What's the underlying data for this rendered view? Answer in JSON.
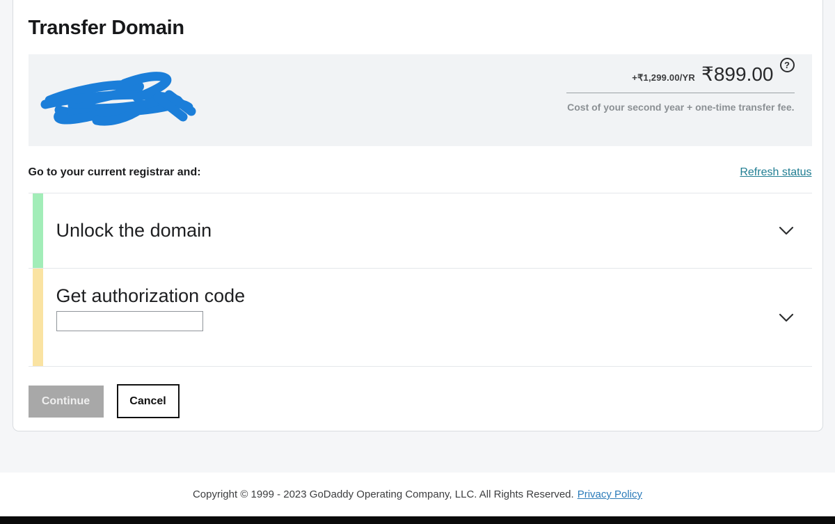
{
  "page": {
    "title": "Transfer Domain"
  },
  "pricing": {
    "renewal_price_per_year": "+₹1,299.00/YR",
    "transfer_price": "₹899.00",
    "help_glyph": "?",
    "note": "Cost of your second year + one-time transfer fee."
  },
  "instructions": {
    "label": "Go to your current registrar and:",
    "refresh_link": "Refresh status"
  },
  "steps": [
    {
      "title": "Unlock the domain",
      "status_color": "#a2edb8"
    },
    {
      "title": "Get authorization code",
      "status_color": "#fae3a2",
      "input": {
        "value": "",
        "placeholder": ""
      }
    }
  ],
  "actions": {
    "continue_label": "Continue",
    "cancel_label": "Cancel"
  },
  "footer": {
    "copyright": "Copyright © 1999 - 2023 GoDaddy Operating Company, LLC. All Rights Reserved.",
    "privacy_link": "Privacy Policy"
  },
  "colors": {
    "page_background": "#f5f6f8",
    "domain_box_background": "#f1f3f5",
    "step_done_bar": "#a2edb8",
    "step_pending_bar": "#fae3a2",
    "refresh_link": "#1f7d92",
    "privacy_link": "#2b7bb9",
    "continue_disabled": "#a8a8a8",
    "scribble_blue": "#1b7ed9",
    "bottom_bar": "#0a0a0a"
  }
}
